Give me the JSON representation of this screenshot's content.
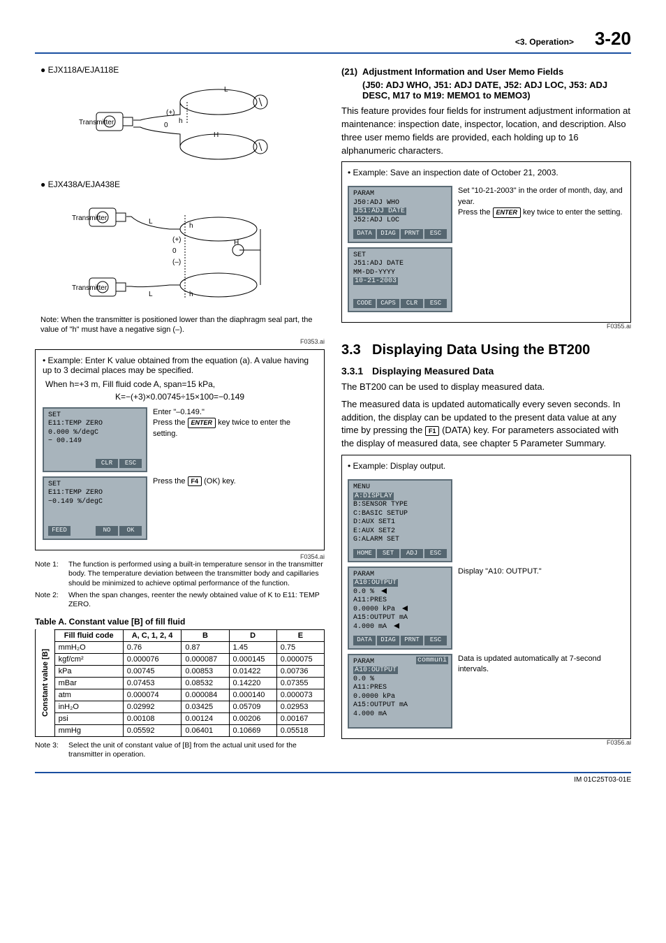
{
  "header": {
    "section": "<3. Operation>",
    "page": "3-20"
  },
  "left": {
    "model1": "● EJX118A/EJA118E",
    "diag1": {
      "label_transmitter": "Transmitter",
      "L": "L",
      "H": "H",
      "h": "h",
      "plus": "(+)",
      "zero": "0"
    },
    "model2": "● EJX438A/EJA438E",
    "diag2": {
      "label_transmitter": "Transmitter",
      "L": "L",
      "H": "H",
      "h": "h",
      "plus": "(+)",
      "minus": "(–)",
      "zero": "0"
    },
    "note_diag": "Note: When the transmitter is positioned lower than the diaphragm seal part, the value of \"h\" must have a negative sign (–).",
    "fig1_id": "F0353.ai",
    "example_box": {
      "line1": "• Example: Enter K value obtained from the equation (a). A value having up to 3 decimal places may be specified.",
      "line2": "When h=+3 m, Fill fluid code A, span=15 kPa,",
      "line3": "K=−(+3)×0.00745÷15×100=−0.149"
    },
    "lcd1": {
      "l1": "SET",
      "l2": " E11:TEMP ZERO",
      "l3": "    0.000 %/degC",
      "l4": "− 00.149",
      "f": [
        "",
        "",
        "CLR",
        "ESC"
      ]
    },
    "side1": {
      "a": "Enter \"–0.149.\"",
      "b_pre": "Press the ",
      "b_key": "ENTER",
      "b_post": " key twice to enter the setting."
    },
    "lcd2": {
      "l1": "SET",
      "l2": " E11:TEMP ZERO",
      "l3": "   −0.149 %/degC",
      "f": [
        "FEED",
        "",
        "NO",
        "OK"
      ]
    },
    "side2": {
      "a_pre": "Press the ",
      "a_key": "F4",
      "a_post": " (OK) key."
    },
    "fig2_id": "F0354.ai",
    "notes": [
      {
        "label": "Note 1:",
        "text": "The function is performed using a built-in temperature sensor in the transmitter body. The temperature deviation between the transmitter body and capillaries should be minimized to achieve optimal performance of the function."
      },
      {
        "label": "Note 2:",
        "text": "When the span changes, reenter the newly obtained value of K to E11: TEMP ZERO."
      }
    ],
    "table_title": "Table A. Constant value [B] of fill fluid",
    "table": {
      "corner_label": "Constant value [B]",
      "head": [
        "Fill fluid code",
        "A, C, 1, 2, 4",
        "B",
        "D",
        "E"
      ],
      "rows": [
        [
          "mmH₂O",
          "0.76",
          "0.87",
          "1.45",
          "0.75"
        ],
        [
          "kgf/cm²",
          "0.000076",
          "0.000087",
          "0.000145",
          "0.000075"
        ],
        [
          "kPa",
          "0.00745",
          "0.00853",
          "0.01422",
          "0.00736"
        ],
        [
          "mBar",
          "0.07453",
          "0.08532",
          "0.14220",
          "0.07355"
        ],
        [
          "atm",
          "0.000074",
          "0.000084",
          "0.000140",
          "0.000073"
        ],
        [
          "inH₂O",
          "0.02992",
          "0.03425",
          "0.05709",
          "0.02953"
        ],
        [
          "psi",
          "0.00108",
          "0.00124",
          "0.00206",
          "0.00167"
        ],
        [
          "mmHg",
          "0.05592",
          "0.06401",
          "0.10669",
          "0.05518"
        ]
      ]
    },
    "note3": {
      "label": "Note 3:",
      "text": "Select the unit of constant value of [B] from the actual unit used for the transmitter in operation."
    }
  },
  "right": {
    "sec21": {
      "num": "(21)",
      "title": "Adjustment Information and User Memo Fields",
      "subtitle": "(J50: ADJ WHO, J51: ADJ DATE, J52: ADJ LOC, J53: ADJ DESC, M17 to M19: MEMO1 to MEMO3)"
    },
    "para1": "This feature provides four fields for instrument adjustment information at maintenance: inspection date, inspector, location, and description. Also three user memo fields are provided, each holding up to 16 alphanumeric characters.",
    "example1": "• Example: Save an inspection date of October 21, 2003.",
    "lcdA": {
      "l1": "PARAM",
      "l2": " J50:ADJ WHO",
      "l3": " J51:ADJ DATE",
      "l4": " J52:ADJ LOC",
      "f": [
        "DATA",
        "DIAG",
        "PRNT",
        "ESC"
      ]
    },
    "sideA": {
      "a": "Set \"10-21-2003\" in the order of month, day, and year.",
      "b_pre": "Press the ",
      "b_key": "ENTER",
      "b_post": " key twice to enter the setting."
    },
    "lcdB": {
      "l1": "SET",
      "l2": " J51:ADJ DATE",
      "l3": "    MM-DD-YYYY",
      "l4": "   10-21-2003",
      "f": [
        "CODE",
        "CAPS",
        "CLR",
        "ESC"
      ]
    },
    "fig3_id": "F0355.ai",
    "h33_num": "3.3",
    "h33_title": "Displaying Data Using the BT200",
    "h331_num": "3.3.1",
    "h331_title": "Displaying Measured Data",
    "para2": "The BT200 can be used to display measured data.",
    "para3_a": "The measured data is updated automatically every seven seconds. In addition, the display can be updated to the present data value at any time by pressing the ",
    "para3_key": "F1",
    "para3_b": " (DATA) key. For parameters associated with the display of measured data, see chapter 5 Parameter Summary.",
    "example2": "• Example: Display output.",
    "lcdC": {
      "l1": "MENU",
      "l2": " A:DISPLAY",
      "l3": " B:SENSOR TYPE",
      "l4": " C:BASIC SETUP",
      "l5": " D:AUX SET1",
      "l6": " E:AUX SET2",
      "l7": " G:ALARM SET",
      "f": [
        "HOME",
        "SET",
        "ADJ",
        "ESC"
      ]
    },
    "lcdD": {
      "l1": "PARAM",
      "l2": " A10:OUTPUT",
      "l3": "        0.0 %",
      "l4": " A11:PRES",
      "l5": "     0.0000 kPa",
      "l6": " A15:OUTPUT mA",
      "l7": "      4.000 mA",
      "f": [
        "DATA",
        "DIAG",
        "PRNT",
        "ESC"
      ]
    },
    "sideD": "Display \"A10: OUTPUT.\"",
    "lcdE": {
      "l0": "communi",
      "l1": "PARAM",
      "l2": " A10:OUTPUT",
      "l3": "        0.0 %",
      "l4": " A11:PRES",
      "l5": "     0.0000 kPa",
      "l6": " A15:OUTPUT mA",
      "l7": "      4.000 mA",
      "f": [
        "",
        "",
        "",
        ""
      ]
    },
    "sideE": "Data is updated automatically at 7-second intervals.",
    "fig4_id": "F0356.ai"
  },
  "footer": "IM 01C25T03-01E"
}
